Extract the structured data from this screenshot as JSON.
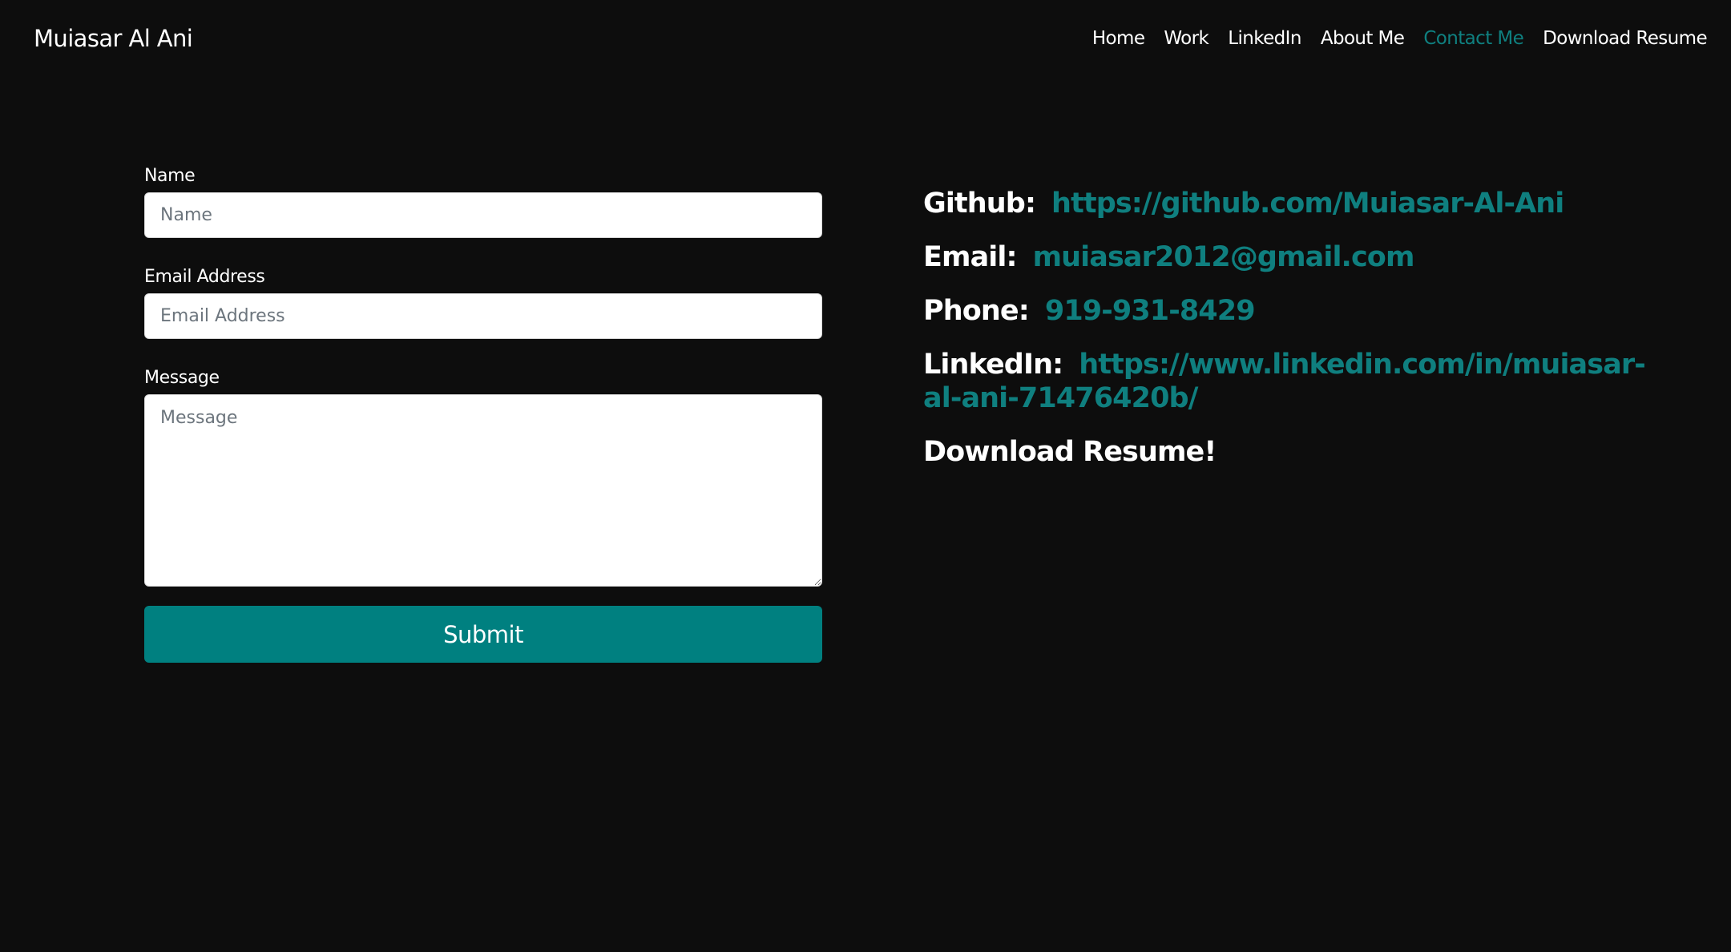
{
  "header": {
    "brand": "Muiasar Al Ani",
    "nav": [
      {
        "label": "Home"
      },
      {
        "label": "Work"
      },
      {
        "label": "LinkedIn"
      },
      {
        "label": "About Me"
      },
      {
        "label": "Contact Me",
        "active": true
      },
      {
        "label": "Download Resume"
      }
    ]
  },
  "form": {
    "name": {
      "label": "Name",
      "placeholder": "Name",
      "value": ""
    },
    "email": {
      "label": "Email Address",
      "placeholder": "Email Address",
      "value": ""
    },
    "message": {
      "label": "Message",
      "placeholder": "Message",
      "value": ""
    },
    "submit_label": "Submit"
  },
  "contact": {
    "github": {
      "label": "Github:",
      "value": "https://github.com/Muiasar-Al-Ani"
    },
    "email": {
      "label": "Email:",
      "value": "muiasar2012@gmail.com"
    },
    "phone": {
      "label": "Phone:",
      "value": "919-931-8429"
    },
    "linkedin": {
      "label": "LinkedIn:",
      "value_line1": "https://www.linkedin.com/in/muiasar-",
      "value_line2": "al-ani-71476420b/"
    },
    "resume_label": "Download Resume!"
  },
  "colors": {
    "background": "#0d0d0d",
    "accent": "#008080",
    "link": "#0f7f7f",
    "active_nav": "#0f8080",
    "text": "#ffffff"
  }
}
